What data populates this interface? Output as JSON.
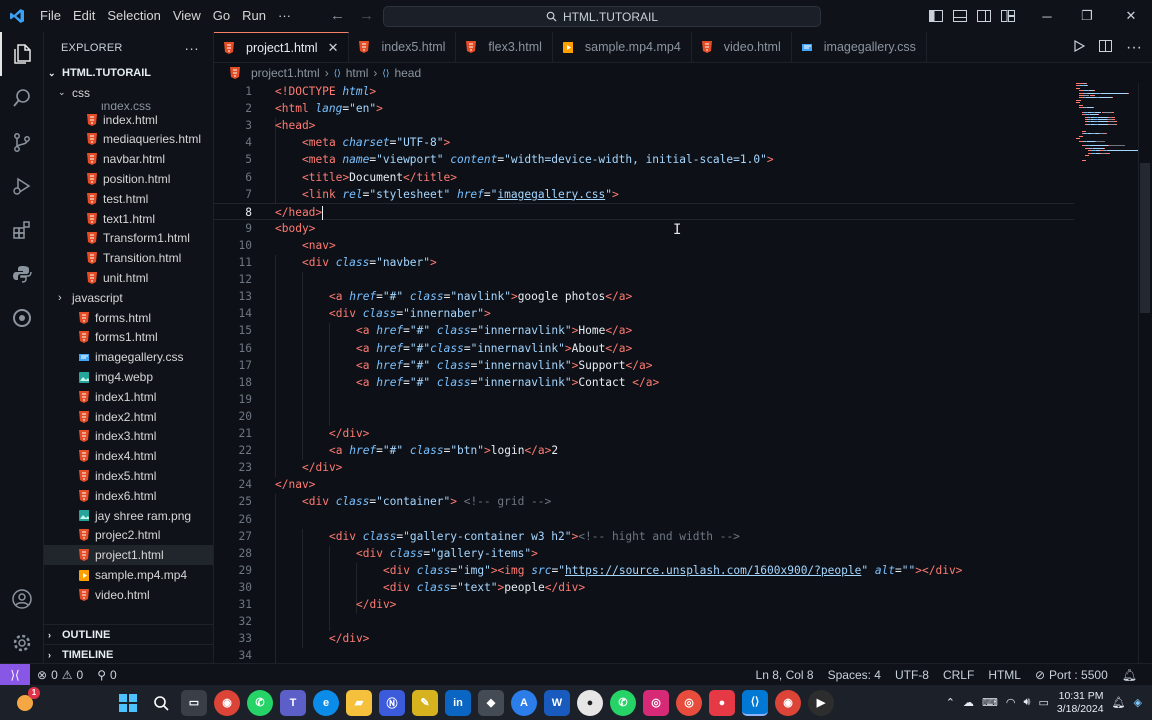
{
  "titlebar": {
    "menus": [
      "File",
      "Edit",
      "Selection",
      "View",
      "Go",
      "Run",
      "···"
    ],
    "search_text": "HTML.TUTORAIL"
  },
  "explorer": {
    "header": "EXPLORER",
    "root": "HTML.TUTORAIL",
    "folder_css": "css",
    "clipped_item": "index.css",
    "css_files": [
      "index.html",
      "mediaqueries.html",
      "navbar.html",
      "position.html",
      "test.html",
      "text1.html",
      "Transform1.html",
      "Transition.html",
      "unit.html"
    ],
    "folder_js": "javascript",
    "root_files": [
      {
        "name": "forms.html",
        "type": "html"
      },
      {
        "name": "forms1.html",
        "type": "html"
      },
      {
        "name": "imagegallery.css",
        "type": "css"
      },
      {
        "name": "img4.webp",
        "type": "img"
      },
      {
        "name": "index1.html",
        "type": "html"
      },
      {
        "name": "index2.html",
        "type": "html"
      },
      {
        "name": "index3.html",
        "type": "html"
      },
      {
        "name": "index4.html",
        "type": "html"
      },
      {
        "name": "index5.html",
        "type": "html"
      },
      {
        "name": "index6.html",
        "type": "html"
      },
      {
        "name": "jay shree ram.png",
        "type": "img"
      },
      {
        "name": "projec2.html",
        "type": "html"
      },
      {
        "name": "project1.html",
        "type": "html",
        "selected": true
      },
      {
        "name": "sample.mp4.mp4",
        "type": "video"
      },
      {
        "name": "video.html",
        "type": "html"
      }
    ],
    "outline": "OUTLINE",
    "timeline": "TIMELINE"
  },
  "tabs": [
    {
      "label": "project1.html",
      "active": true,
      "type": "html"
    },
    {
      "label": "index5.html",
      "type": "html"
    },
    {
      "label": "flex3.html",
      "type": "html"
    },
    {
      "label": "sample.mp4.mp4",
      "type": "video"
    },
    {
      "label": "video.html",
      "type": "html"
    },
    {
      "label": "imagegallery.css",
      "type": "css"
    }
  ],
  "breadcrumb": [
    "project1.html",
    "html",
    "head"
  ],
  "code_lines": [
    {
      "n": "1",
      "indent": 0,
      "t": [
        [
          "tg",
          "<!DOCTYPE "
        ],
        [
          "at",
          "html"
        ],
        [
          "tg",
          ">"
        ]
      ]
    },
    {
      "n": "2",
      "indent": 0,
      "t": [
        [
          "tg",
          "<html "
        ],
        [
          "at",
          "lang"
        ],
        [
          "pl",
          "="
        ],
        [
          "st",
          "\"en\""
        ],
        [
          "tg",
          ">"
        ]
      ]
    },
    {
      "n": "3",
      "indent": 0,
      "t": [
        [
          "tg",
          "<head>"
        ]
      ]
    },
    {
      "n": "4",
      "indent": 1,
      "t": [
        [
          "tg",
          "<meta "
        ],
        [
          "at",
          "charset"
        ],
        [
          "pl",
          "="
        ],
        [
          "st",
          "\"UTF-8\""
        ],
        [
          "tg",
          ">"
        ]
      ]
    },
    {
      "n": "5",
      "indent": 1,
      "t": [
        [
          "tg",
          "<meta "
        ],
        [
          "at",
          "name"
        ],
        [
          "pl",
          "="
        ],
        [
          "st",
          "\"viewport\" "
        ],
        [
          "at",
          "content"
        ],
        [
          "pl",
          "="
        ],
        [
          "st",
          "\"width=device-width, initial-scale=1.0\""
        ],
        [
          "tg",
          ">"
        ]
      ]
    },
    {
      "n": "6",
      "indent": 1,
      "t": [
        [
          "tg",
          "<title>"
        ],
        [
          "pl",
          "Document"
        ],
        [
          "tg",
          "</title>"
        ]
      ]
    },
    {
      "n": "7",
      "indent": 1,
      "t": [
        [
          "tg",
          "<link "
        ],
        [
          "at",
          "rel"
        ],
        [
          "pl",
          "="
        ],
        [
          "st",
          "\"stylesheet\" "
        ],
        [
          "at",
          "href"
        ],
        [
          "pl",
          "="
        ],
        [
          "st",
          "\""
        ],
        [
          "stu",
          "imagegallery.css"
        ],
        [
          "st",
          "\""
        ],
        [
          "tg",
          ">"
        ]
      ]
    },
    {
      "n": "8",
      "indent": 0,
      "t": [
        [
          "tg",
          "</head>"
        ]
      ],
      "current": true
    },
    {
      "n": "9",
      "indent": 0,
      "t": [
        [
          "tg",
          "<body>"
        ]
      ]
    },
    {
      "n": "10",
      "indent": 1,
      "t": [
        [
          "tg",
          "<nav>"
        ]
      ]
    },
    {
      "n": "11",
      "indent": 1,
      "t": [
        [
          "tg",
          "<div "
        ],
        [
          "at",
          "class"
        ],
        [
          "pl",
          "="
        ],
        [
          "st",
          "\"navber\""
        ],
        [
          "tg",
          ">"
        ]
      ]
    },
    {
      "n": "12",
      "indent": 0,
      "t": []
    },
    {
      "n": "13",
      "indent": 2,
      "t": [
        [
          "tg",
          "<a "
        ],
        [
          "at",
          "href"
        ],
        [
          "pl",
          "="
        ],
        [
          "st",
          "\"#\" "
        ],
        [
          "at",
          "class"
        ],
        [
          "pl",
          "="
        ],
        [
          "st",
          "\"navlink\""
        ],
        [
          "tg",
          ">"
        ],
        [
          "pl",
          "google photos"
        ],
        [
          "tg",
          "</a>"
        ]
      ]
    },
    {
      "n": "14",
      "indent": 2,
      "t": [
        [
          "tg",
          "<div "
        ],
        [
          "at",
          "class"
        ],
        [
          "pl",
          "="
        ],
        [
          "st",
          "\"innernaber\""
        ],
        [
          "tg",
          ">"
        ]
      ]
    },
    {
      "n": "15",
      "indent": 3,
      "t": [
        [
          "tg",
          "<a "
        ],
        [
          "at",
          "href"
        ],
        [
          "pl",
          "="
        ],
        [
          "st",
          "\"#\" "
        ],
        [
          "at",
          "class"
        ],
        [
          "pl",
          "="
        ],
        [
          "st",
          "\"innernavlink\""
        ],
        [
          "tg",
          ">"
        ],
        [
          "pl",
          "Home"
        ],
        [
          "tg",
          "</a>"
        ]
      ]
    },
    {
      "n": "16",
      "indent": 3,
      "t": [
        [
          "tg",
          "<a "
        ],
        [
          "at",
          "href"
        ],
        [
          "pl",
          "="
        ],
        [
          "st",
          "\"#\""
        ],
        [
          "at",
          "class"
        ],
        [
          "pl",
          "="
        ],
        [
          "st",
          "\"innernavlink\""
        ],
        [
          "tg",
          ">"
        ],
        [
          "pl",
          "About"
        ],
        [
          "tg",
          "</a>"
        ]
      ]
    },
    {
      "n": "17",
      "indent": 3,
      "t": [
        [
          "tg",
          "<a "
        ],
        [
          "at",
          "href"
        ],
        [
          "pl",
          "="
        ],
        [
          "st",
          "\"#\" "
        ],
        [
          "at",
          "class"
        ],
        [
          "pl",
          "="
        ],
        [
          "st",
          "\"innernavlink\""
        ],
        [
          "tg",
          ">"
        ],
        [
          "pl",
          "Support"
        ],
        [
          "tg",
          "</a>"
        ]
      ]
    },
    {
      "n": "18",
      "indent": 3,
      "t": [
        [
          "tg",
          "<a "
        ],
        [
          "at",
          "href"
        ],
        [
          "pl",
          "="
        ],
        [
          "st",
          "\"#\" "
        ],
        [
          "at",
          "class"
        ],
        [
          "pl",
          "="
        ],
        [
          "st",
          "\"innernavlink\""
        ],
        [
          "tg",
          ">"
        ],
        [
          "pl",
          "Contact "
        ],
        [
          "tg",
          "</a>"
        ]
      ]
    },
    {
      "n": "19",
      "indent": 0,
      "t": []
    },
    {
      "n": "20",
      "indent": 0,
      "t": []
    },
    {
      "n": "21",
      "indent": 2,
      "t": [
        [
          "tg",
          "</div>"
        ]
      ]
    },
    {
      "n": "22",
      "indent": 2,
      "t": [
        [
          "tg",
          "<a "
        ],
        [
          "at",
          "href"
        ],
        [
          "pl",
          "="
        ],
        [
          "st",
          "\"#\" "
        ],
        [
          "at",
          "class"
        ],
        [
          "pl",
          "="
        ],
        [
          "st",
          "\"btn\""
        ],
        [
          "tg",
          ">"
        ],
        [
          "pl",
          "login"
        ],
        [
          "tg",
          "</a>"
        ],
        [
          "pl",
          "2"
        ]
      ]
    },
    {
      "n": "23",
      "indent": 1,
      "t": [
        [
          "tg",
          "</div>"
        ]
      ]
    },
    {
      "n": "24",
      "indent": 0,
      "t": [
        [
          "tg",
          "</nav>"
        ]
      ]
    },
    {
      "n": "25",
      "indent": 1,
      "t": [
        [
          "tg",
          "<div "
        ],
        [
          "at",
          "class"
        ],
        [
          "pl",
          "="
        ],
        [
          "st",
          "\"container\""
        ],
        [
          "tg",
          "> "
        ],
        [
          "cm",
          "<!-- grid -->"
        ]
      ]
    },
    {
      "n": "26",
      "indent": 0,
      "t": []
    },
    {
      "n": "27",
      "indent": 2,
      "t": [
        [
          "tg",
          "<div "
        ],
        [
          "at",
          "class"
        ],
        [
          "pl",
          "="
        ],
        [
          "st",
          "\"gallery-container w3 h2\""
        ],
        [
          "tg",
          ">"
        ],
        [
          "cm",
          "<!-- hight and width -->"
        ]
      ]
    },
    {
      "n": "28",
      "indent": 3,
      "t": [
        [
          "tg",
          "<div "
        ],
        [
          "at",
          "class"
        ],
        [
          "pl",
          "="
        ],
        [
          "st",
          "\"gallery-items\""
        ],
        [
          "tg",
          ">"
        ]
      ]
    },
    {
      "n": "29",
      "indent": 4,
      "t": [
        [
          "tg",
          "<div "
        ],
        [
          "at",
          "class"
        ],
        [
          "pl",
          "="
        ],
        [
          "st",
          "\"img\""
        ],
        [
          "tg",
          "><img "
        ],
        [
          "at",
          "src"
        ],
        [
          "pl",
          "="
        ],
        [
          "st",
          "\""
        ],
        [
          "stu",
          "https://source.unsplash.com/1600x900/?people"
        ],
        [
          "st",
          "\" "
        ],
        [
          "at",
          "alt"
        ],
        [
          "pl",
          "="
        ],
        [
          "st",
          "\"\""
        ],
        [
          "tg",
          "></div>"
        ]
      ]
    },
    {
      "n": "30",
      "indent": 4,
      "t": [
        [
          "tg",
          "<div "
        ],
        [
          "at",
          "class"
        ],
        [
          "pl",
          "="
        ],
        [
          "st",
          "\"text\""
        ],
        [
          "tg",
          ">"
        ],
        [
          "pl",
          "people"
        ],
        [
          "tg",
          "</div>"
        ]
      ]
    },
    {
      "n": "31",
      "indent": 3,
      "t": [
        [
          "tg",
          "</div>"
        ]
      ]
    },
    {
      "n": "32",
      "indent": 0,
      "t": []
    },
    {
      "n": "33",
      "indent": 2,
      "t": [
        [
          "tg",
          "</div>"
        ]
      ]
    },
    {
      "n": "34",
      "indent": 0,
      "t": []
    }
  ],
  "status": {
    "errors": "0",
    "warnings": "0",
    "ports": "0",
    "position": "Ln 8, Col 8",
    "spaces": "Spaces: 4",
    "encoding": "UTF-8",
    "eol": "CRLF",
    "language": "HTML",
    "port": "Port : 5500"
  },
  "taskbar": {
    "time": "10:31 PM",
    "date": "3/18/2024",
    "notification_count": "1"
  },
  "colors": {
    "accent": "#f78166",
    "html_icon": "#e44d26",
    "css_icon": "#42a5f5",
    "remote": "#8957e5"
  }
}
